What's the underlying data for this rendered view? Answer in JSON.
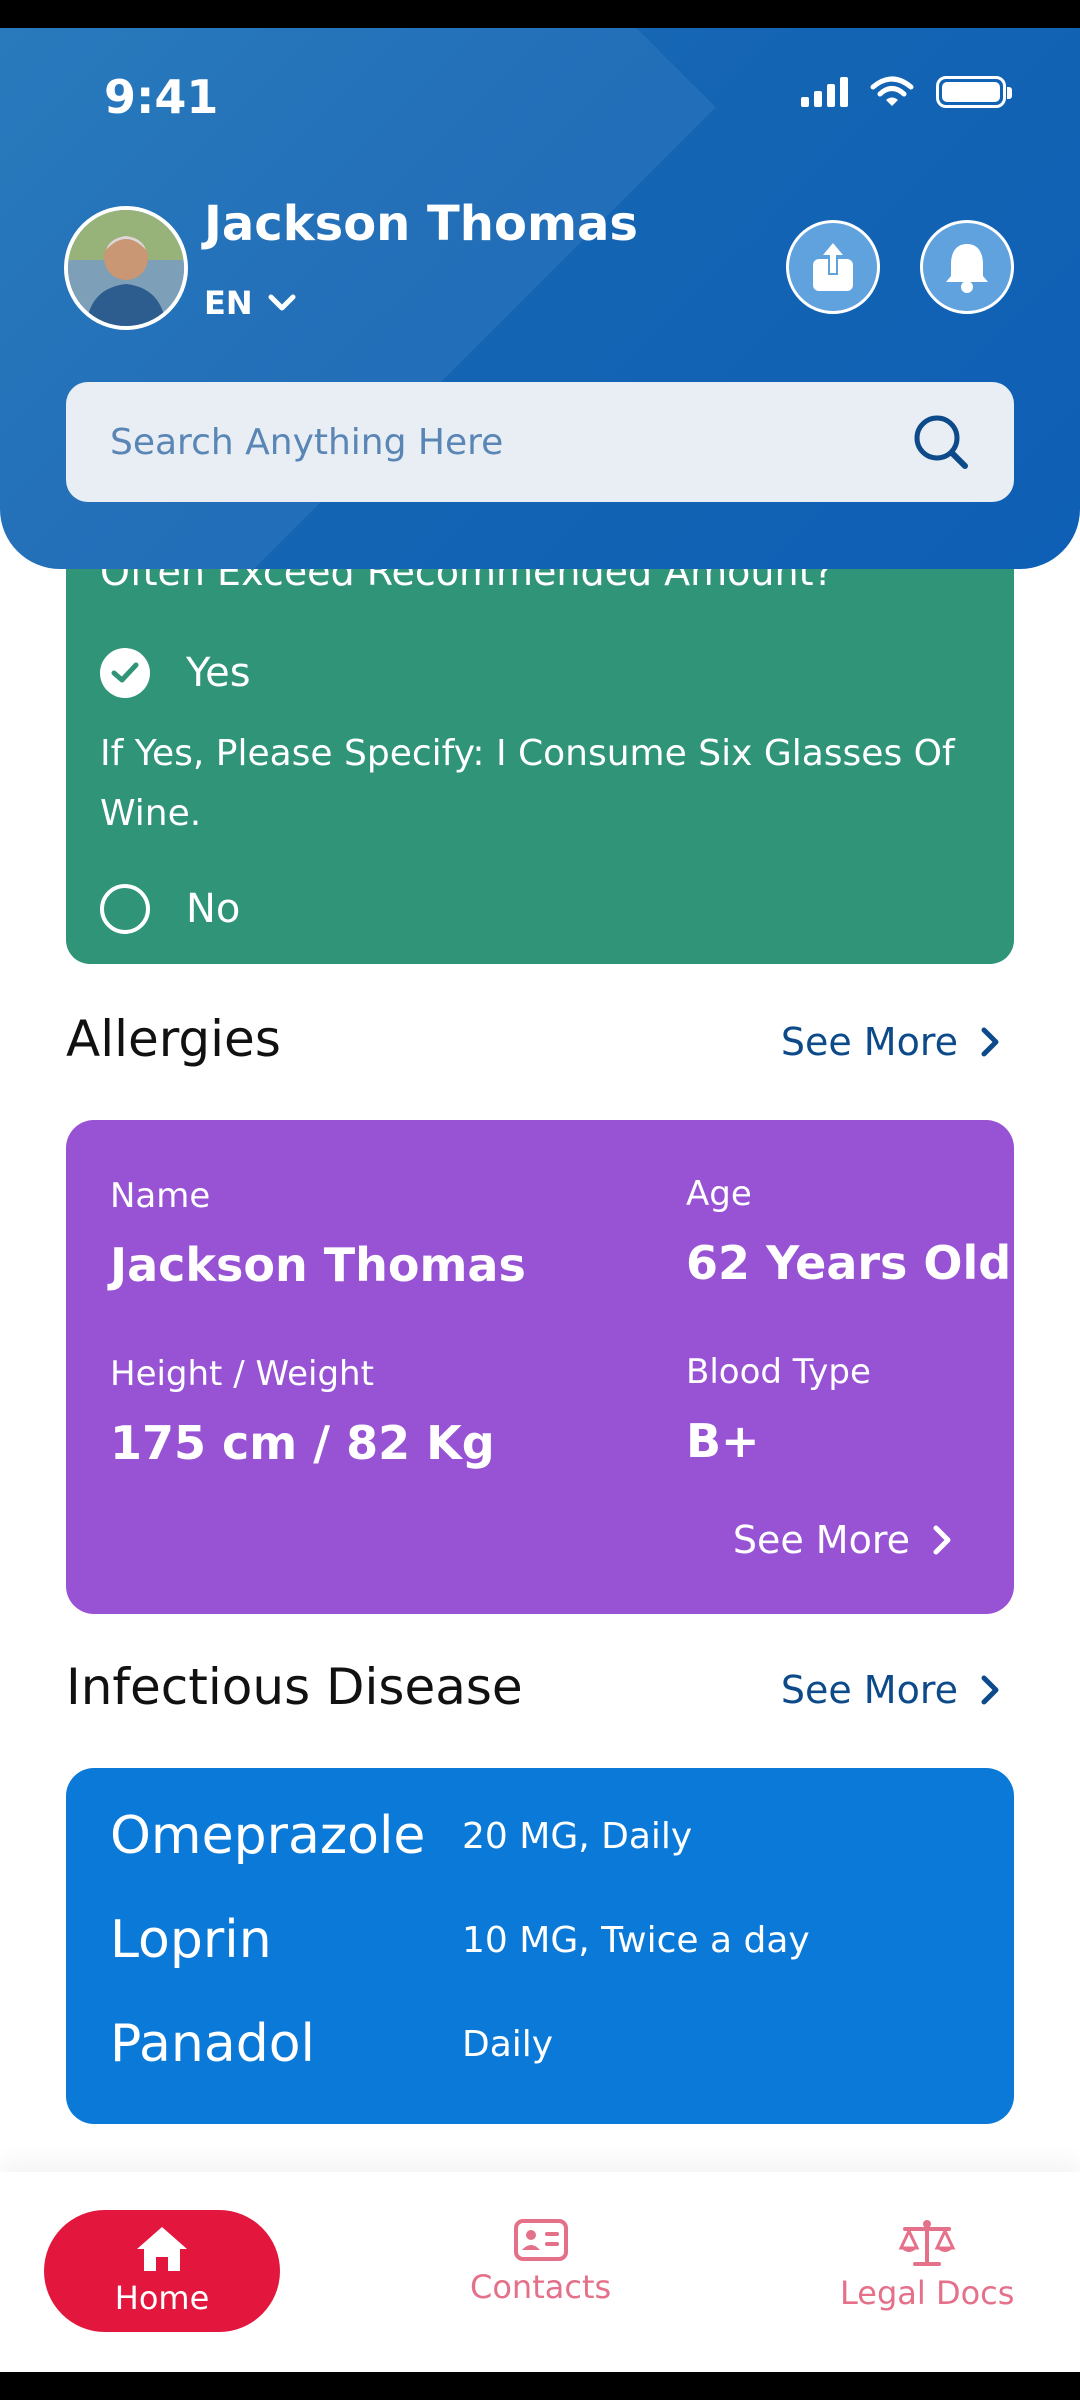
{
  "status_bar": {
    "time": "9:41"
  },
  "header": {
    "user_name": "Jackson Thomas",
    "language": "EN",
    "search_placeholder": "Search Anything Here"
  },
  "alcohol_card": {
    "question": "Often Exceed Recommended Amount?",
    "option_yes": "Yes",
    "specify_text": "If Yes, Please Specify: I Consume Six Glasses Of Wine.",
    "option_no": "No",
    "selected": "Yes"
  },
  "allergies": {
    "title": "Allergies",
    "see_more": "See More",
    "name_label": "Name",
    "name_value": "Jackson Thomas",
    "age_label": "Age",
    "age_value": "62 Years Old",
    "hw_label": "Height / Weight",
    "hw_value": "175 cm / 82 Kg",
    "blood_label": "Blood Type",
    "blood_value": "B+",
    "card_see_more": "See More"
  },
  "infectious": {
    "title": "Infectious Disease",
    "see_more": "See More",
    "medications": [
      {
        "name": "Omeprazole",
        "dose": "20 MG, Daily"
      },
      {
        "name": "Loprin",
        "dose": "10 MG, Twice a day"
      },
      {
        "name": "Panadol",
        "dose": "Daily"
      }
    ]
  },
  "nav": {
    "home": "Home",
    "contacts": "Contacts",
    "legal": "Legal Docs"
  },
  "colors": {
    "header_blue": "#1565b4",
    "green_card": "#2f9478",
    "purple_card": "#9852d4",
    "blue_card": "#0a79d8",
    "nav_active": "#e3173e",
    "nav_inactive": "#e5708a"
  }
}
